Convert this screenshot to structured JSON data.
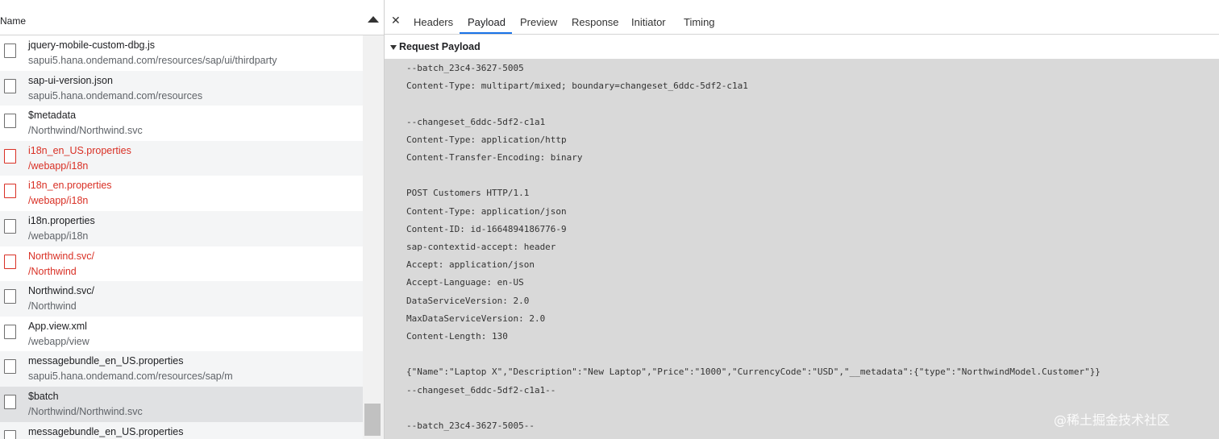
{
  "network_list": {
    "header_label": "Name",
    "requests": [
      {
        "name": "jquery-mobile-custom-dbg.js",
        "path": "sapui5.hana.ondemand.com/resources/sap/ui/thirdparty",
        "status": "ok"
      },
      {
        "name": "sap-ui-version.json",
        "path": "sapui5.hana.ondemand.com/resources",
        "status": "ok"
      },
      {
        "name": "$metadata",
        "path": "/Northwind/Northwind.svc",
        "status": "ok"
      },
      {
        "name": "i18n_en_US.properties",
        "path": "/webapp/i18n",
        "status": "error"
      },
      {
        "name": "i18n_en.properties",
        "path": "/webapp/i18n",
        "status": "error"
      },
      {
        "name": "i18n.properties",
        "path": "/webapp/i18n",
        "status": "ok"
      },
      {
        "name": "Northwind.svc/",
        "path": "/Northwind",
        "status": "error"
      },
      {
        "name": "Northwind.svc/",
        "path": "/Northwind",
        "status": "ok"
      },
      {
        "name": "App.view.xml",
        "path": "/webapp/view",
        "status": "ok"
      },
      {
        "name": "messagebundle_en_US.properties",
        "path": "sapui5.hana.ondemand.com/resources/sap/m",
        "status": "ok"
      },
      {
        "name": "$batch",
        "path": "/Northwind/Northwind.svc",
        "status": "selected"
      },
      {
        "name": "messagebundle_en_US.properties",
        "path": "",
        "status": "ok"
      }
    ]
  },
  "details": {
    "close_icon": "close-icon",
    "tabs": [
      {
        "label": "Headers"
      },
      {
        "label": "Payload"
      },
      {
        "label": "Preview"
      },
      {
        "label": "Response"
      },
      {
        "label": "Initiator"
      },
      {
        "label": "Timing"
      }
    ],
    "active_tab": "Payload",
    "section_title": "Request Payload",
    "payload_lines": [
      "--batch_23c4-3627-5005",
      "Content-Type: multipart/mixed; boundary=changeset_6ddc-5df2-c1a1",
      "",
      "--changeset_6ddc-5df2-c1a1",
      "Content-Type: application/http",
      "Content-Transfer-Encoding: binary",
      "",
      "POST Customers HTTP/1.1",
      "Content-Type: application/json",
      "Content-ID: id-1664894186776-9",
      "sap-contextid-accept: header",
      "Accept: application/json",
      "Accept-Language: en-US",
      "DataServiceVersion: 2.0",
      "MaxDataServiceVersion: 2.0",
      "Content-Length: 130",
      "",
      "{\"Name\":\"Laptop X\",\"Description\":\"New Laptop\",\"Price\":\"1000\",\"CurrencyCode\":\"USD\",\"__metadata\":{\"type\":\"NorthwindModel.Customer\"}}",
      "--changeset_6ddc-5df2-c1a1--",
      "",
      "--batch_23c4-3627-5005--"
    ]
  },
  "watermark": "@稀土掘金技术社区",
  "colors": {
    "accent": "#1a73e8",
    "error": "#d93025",
    "payload_bg": "#d9d9d9"
  }
}
